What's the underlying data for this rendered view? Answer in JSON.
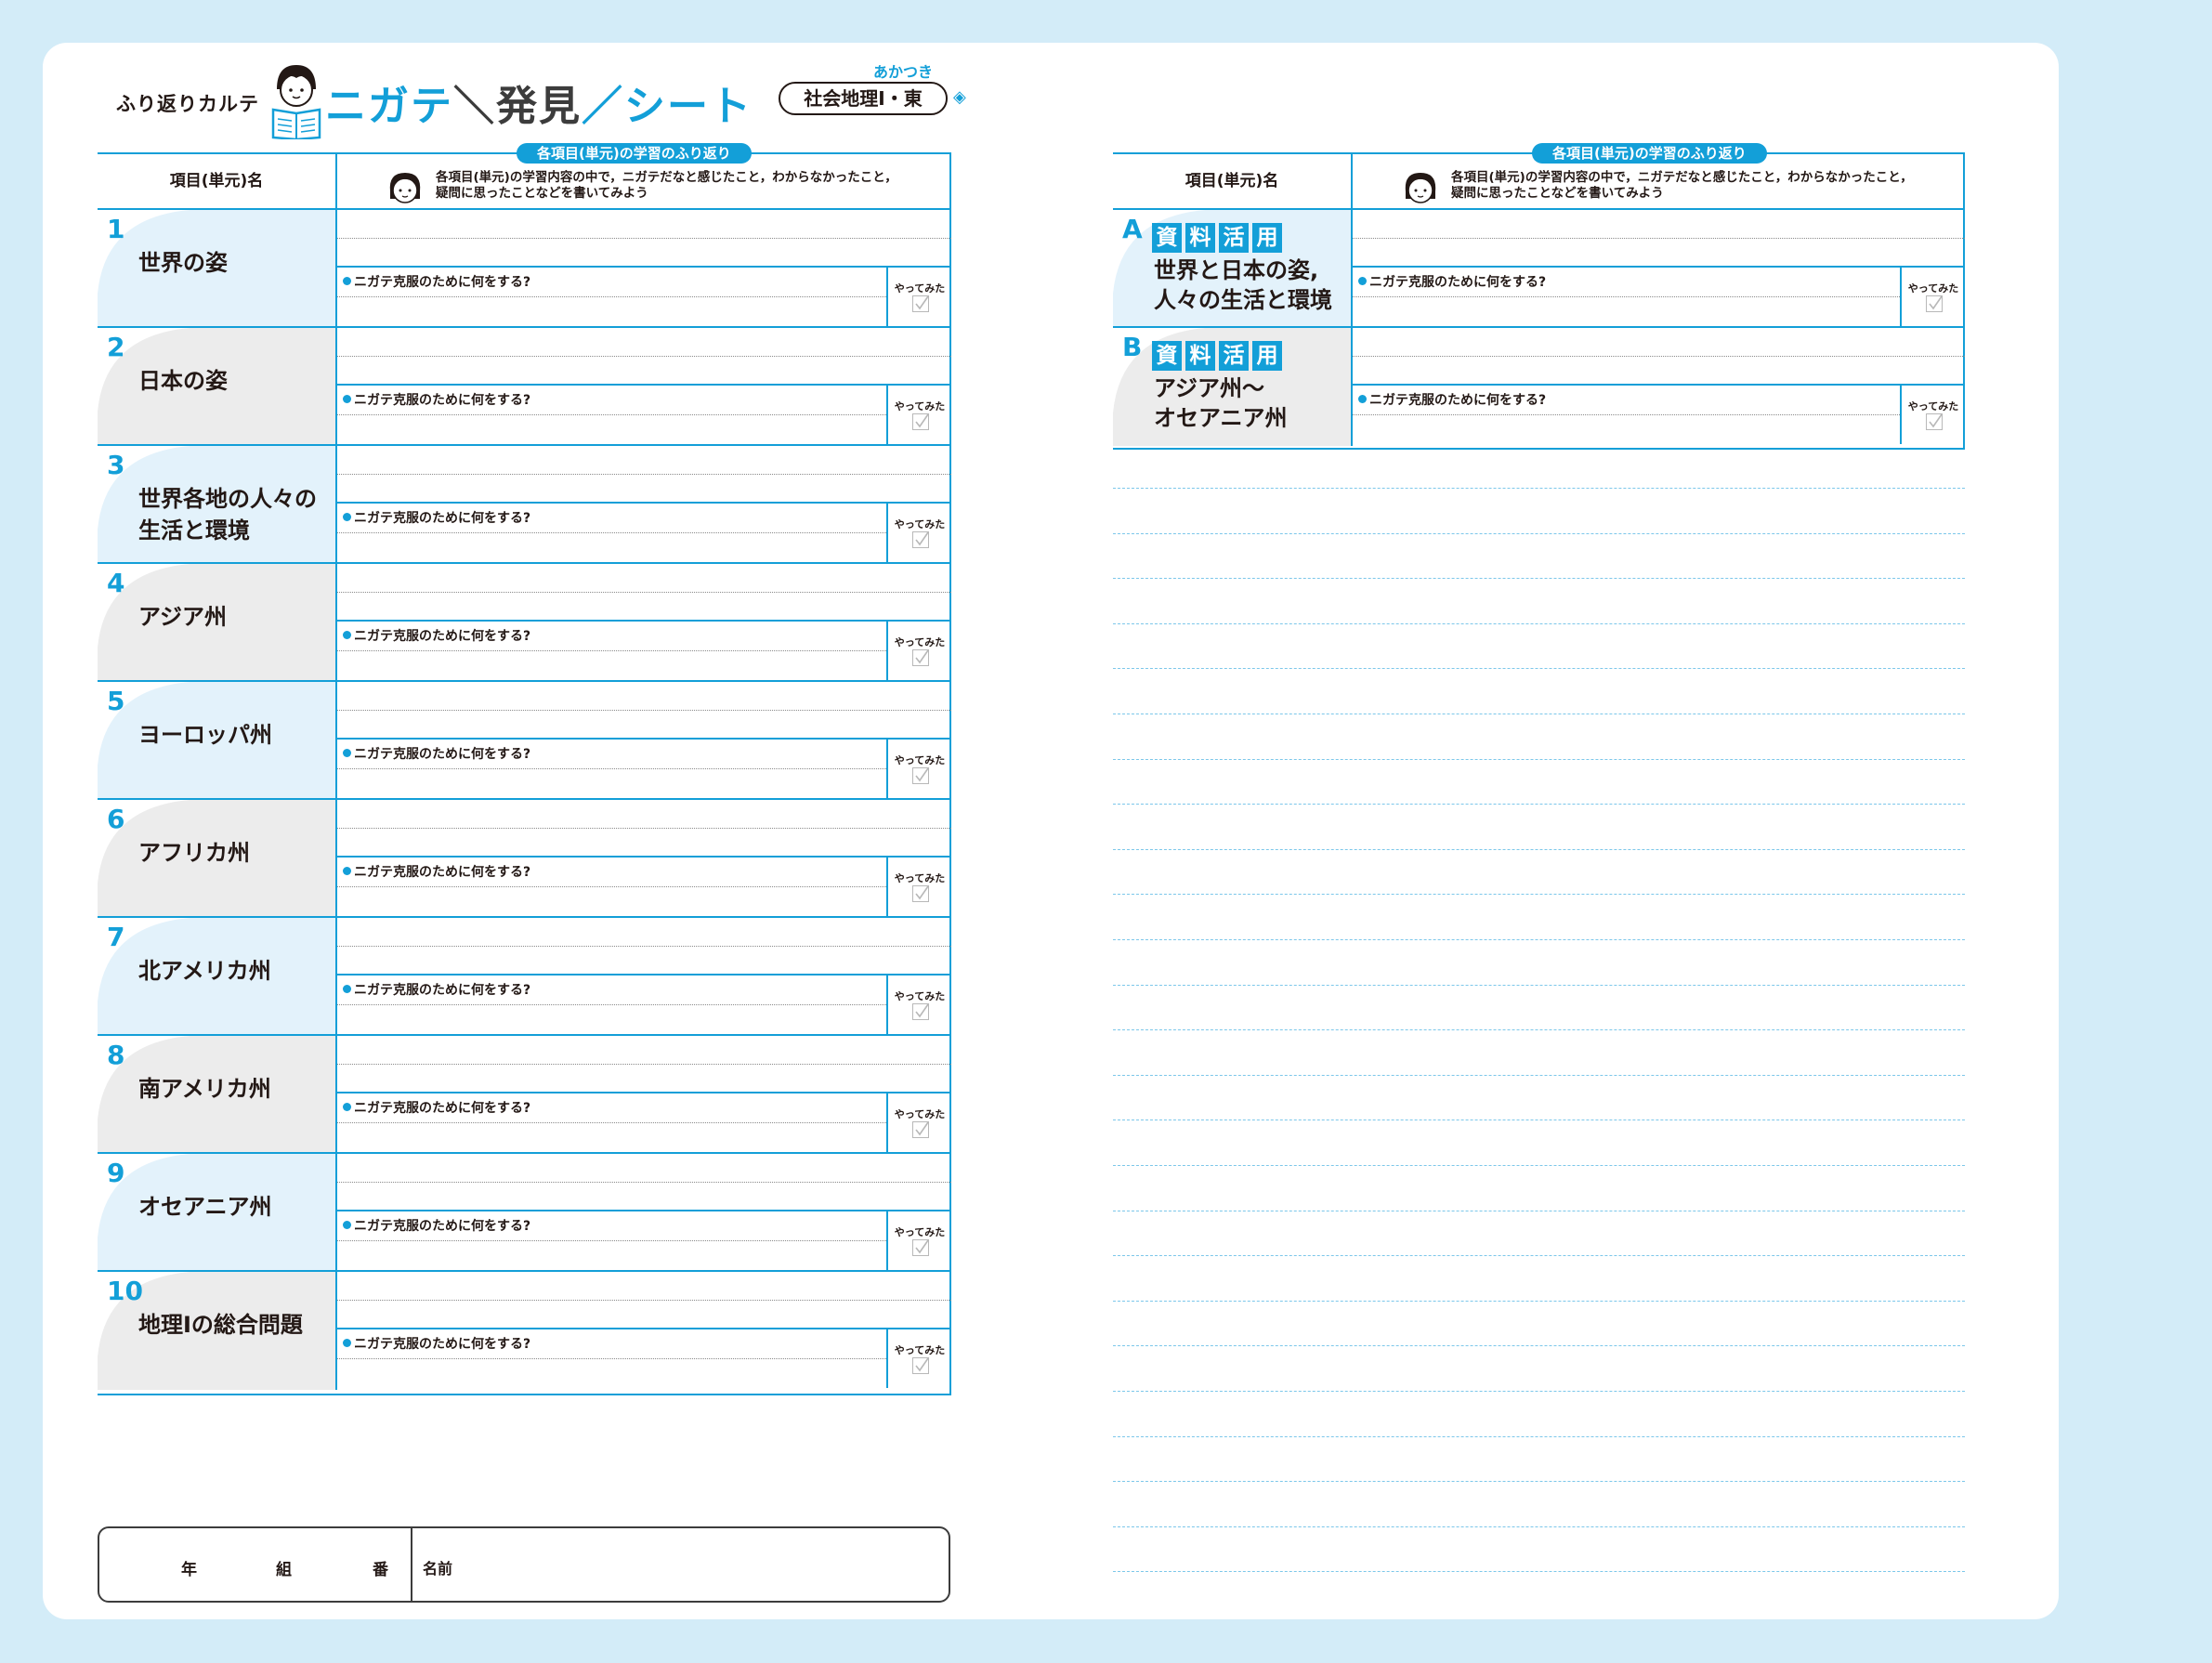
{
  "header": {
    "karte": "ふり返りカルテ",
    "title_1": "ニガテ",
    "title_sep1": "＼",
    "title_2": "発見",
    "title_sep2": "／",
    "title_3": "シート",
    "brand": "あかつき",
    "subject": "社会地理I・東"
  },
  "table": {
    "col1_header": "項目(単元)名",
    "banner": "各項目(単元)の学習のふり返り",
    "instruction_1": "各項目(単元)の学習内容の中で，ニガテだなと感じたこと，わからなかったこと，",
    "instruction_2": "疑問に思ったことなどを書いてみよう",
    "prompt": "ニガテ克服のために何をする?",
    "check_label": "やってみた"
  },
  "left_rows": [
    {
      "num": "1",
      "name1": "世界の姿",
      "name2": ""
    },
    {
      "num": "2",
      "name1": "日本の姿",
      "name2": ""
    },
    {
      "num": "3",
      "name1": "世界各地の人々の",
      "name2": "生活と環境"
    },
    {
      "num": "4",
      "name1": "アジア州",
      "name2": ""
    },
    {
      "num": "5",
      "name1": "ヨーロッパ州",
      "name2": ""
    },
    {
      "num": "6",
      "name1": "アフリカ州",
      "name2": ""
    },
    {
      "num": "7",
      "name1": "北アメリカ州",
      "name2": ""
    },
    {
      "num": "8",
      "name1": "南アメリカ州",
      "name2": ""
    },
    {
      "num": "9",
      "name1": "オセアニア州",
      "name2": ""
    },
    {
      "num": "10",
      "name1": "地理Iの総合問題",
      "name2": ""
    }
  ],
  "right_rows": [
    {
      "num": "A",
      "tags": [
        "資",
        "料",
        "活",
        "用"
      ],
      "name1": "世界と日本の姿,",
      "name2": "人々の生活と環境"
    },
    {
      "num": "B",
      "tags": [
        "資",
        "料",
        "活",
        "用"
      ],
      "name1": "アジア州～",
      "name2": "オセアニア州"
    }
  ],
  "namebox": {
    "year": "年",
    "class": "組",
    "number": "番",
    "name": "名前"
  },
  "colors": {
    "accent": "#139fd8",
    "background": "#d3ecf8",
    "wedge_blue": "#e3f2fb",
    "wedge_gray": "#ececec"
  }
}
